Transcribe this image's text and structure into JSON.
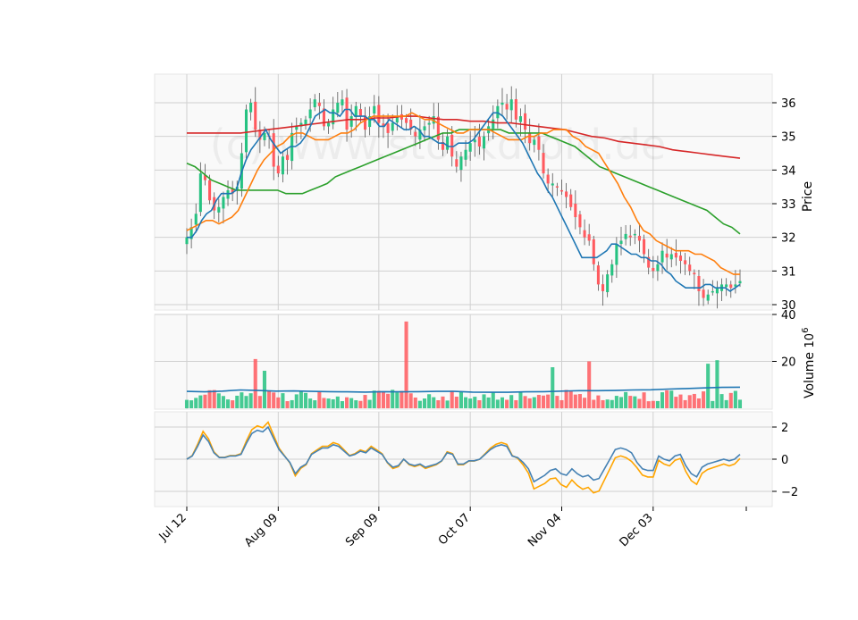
{
  "chart_data": {
    "type": "candlestick",
    "watermark": "(c) www.stockdroid.de",
    "x_ticks": [
      "Jul 12",
      "Aug 09",
      "Sep 09",
      "Oct 07",
      "Nov 04",
      "Dec 03"
    ],
    "x_tick_days": [
      0,
      20,
      42,
      62,
      82,
      102
    ],
    "n_days": 122,
    "colors": {
      "up": "#26c281",
      "down": "#ff5a5f",
      "ma5": "#1f77b4",
      "ma10": "#ff7f0e",
      "ma20": "#2ca02c",
      "ma50": "#d62728",
      "volume_ma": "#1f77b4",
      "osc_a": "#4682b4",
      "osc_b": "#ffa500"
    },
    "price": {
      "ylabel": "Price",
      "ylim": [
        29.7,
        36.8
      ],
      "yticks": [
        30,
        31,
        32,
        33,
        34,
        35,
        36
      ],
      "closes": [
        32.0,
        32.3,
        32.7,
        33.9,
        33.7,
        33.1,
        32.8,
        32.9,
        33.2,
        33.4,
        33.3,
        33.5,
        34.5,
        35.8,
        36.0,
        35.2,
        34.9,
        35.1,
        35.0,
        34.1,
        33.9,
        34.4,
        34.3,
        35.1,
        35.3,
        35.4,
        35.5,
        35.8,
        36.1,
        35.9,
        35.3,
        35.4,
        35.8,
        36.0,
        36.1,
        35.2,
        35.6,
        35.9,
        35.6,
        35.2,
        35.6,
        35.9,
        35.4,
        35.3,
        35.1,
        35.4,
        35.6,
        35.5,
        35.4,
        35.2,
        35.0,
        35.2,
        35.3,
        35.4,
        35.6,
        34.9,
        34.6,
        35.0,
        34.4,
        34.1,
        34.4,
        34.6,
        34.8,
        34.9,
        34.7,
        35.0,
        35.3,
        35.5,
        35.9,
        36.0,
        35.8,
        36.1,
        35.5,
        35.6,
        35.2,
        34.8,
        34.9,
        34.6,
        33.9,
        33.6,
        33.6,
        33.5,
        33.4,
        33.2,
        32.9,
        32.6,
        32.3,
        32.0,
        31.9,
        31.2,
        30.6,
        30.4,
        30.9,
        31.2,
        31.8,
        31.9,
        32.1,
        32.0,
        32.1,
        31.9,
        31.5,
        31.1,
        31.0,
        31.2,
        31.6,
        31.4,
        31.5,
        31.4,
        31.3,
        31.2,
        31.0,
        30.9,
        30.4,
        30.2,
        30.3,
        30.4,
        30.5,
        30.6,
        30.6,
        30.5,
        30.6,
        30.7
      ],
      "ma5": [
        32.0,
        32.0,
        32.2,
        32.5,
        32.7,
        32.8,
        33.1,
        33.3,
        33.3,
        33.3,
        33.4,
        33.9,
        34.3,
        34.6,
        34.8,
        35.0,
        35.2,
        34.9,
        34.7,
        34.5,
        34.6,
        34.7,
        34.7,
        34.8,
        35.0,
        35.3,
        35.6,
        35.7,
        35.8,
        35.7,
        35.7,
        35.6,
        35.8,
        35.8,
        35.6,
        35.6,
        35.6,
        35.5,
        35.5,
        35.3,
        35.3,
        35.5,
        35.4,
        35.3,
        35.2,
        35.2,
        35.3,
        35.2,
        35.0,
        35.0,
        34.9,
        34.8,
        34.8,
        34.7,
        34.7,
        34.8,
        34.8,
        34.8,
        34.9,
        35.1,
        35.3,
        35.5,
        35.7,
        35.7,
        35.6,
        35.4,
        35.2,
        35.0,
        34.8,
        34.5,
        34.2,
        33.9,
        33.7,
        33.4,
        33.2,
        32.9,
        32.6,
        32.3,
        32.0,
        31.7,
        31.4,
        31.4,
        31.4,
        31.4,
        31.5,
        31.6,
        31.8,
        31.8,
        31.7,
        31.6,
        31.5,
        31.5,
        31.4,
        31.4,
        31.3,
        31.3,
        31.2,
        31.0,
        30.9,
        30.7,
        30.6,
        30.5,
        30.5,
        30.5,
        30.5,
        30.6,
        30.6,
        30.5,
        30.5,
        30.5,
        30.4,
        30.5,
        30.6
      ],
      "ma10": [
        32.2,
        32.3,
        32.4,
        32.5,
        32.5,
        32.4,
        32.5,
        32.6,
        32.8,
        33.2,
        33.6,
        34.0,
        34.3,
        34.5,
        34.7,
        34.8,
        35.0,
        35.1,
        35.1,
        35.0,
        34.9,
        34.9,
        34.9,
        35.0,
        35.1,
        35.1,
        35.2,
        35.4,
        35.5,
        35.6,
        35.6,
        35.6,
        35.6,
        35.6,
        35.6,
        35.7,
        35.6,
        35.5,
        35.5,
        35.4,
        35.3,
        35.2,
        35.1,
        35.1,
        35.2,
        35.2,
        35.2,
        35.2,
        35.1,
        35.0,
        34.9,
        34.9,
        34.9,
        35.0,
        35.0,
        35.1,
        35.1,
        35.2,
        35.2,
        35.2,
        35.0,
        34.9,
        34.7,
        34.6,
        34.5,
        34.2,
        33.9,
        33.6,
        33.2,
        32.9,
        32.5,
        32.2,
        32.1,
        31.9,
        31.8,
        31.7,
        31.6,
        31.6,
        31.6,
        31.5,
        31.5,
        31.4,
        31.3,
        31.1,
        31.0,
        30.9,
        30.9
      ],
      "ma20": [
        34.2,
        34.1,
        33.9,
        33.7,
        33.6,
        33.5,
        33.4,
        33.4,
        33.4,
        33.4,
        33.4,
        33.4,
        33.3,
        33.3,
        33.3,
        33.4,
        33.5,
        33.6,
        33.8,
        33.9,
        34.0,
        34.1,
        34.2,
        34.3,
        34.4,
        34.5,
        34.6,
        34.7,
        34.8,
        34.9,
        35.0,
        35.1,
        35.1,
        35.2,
        35.2,
        35.2,
        35.2,
        35.2,
        35.2,
        35.1,
        35.1,
        35.1,
        35.1,
        35.1,
        35.0,
        34.9,
        34.8,
        34.7,
        34.5,
        34.3,
        34.1,
        34.0,
        33.9,
        33.8,
        33.7,
        33.6,
        33.5,
        33.4,
        33.3,
        33.2,
        33.1,
        33.0,
        32.9,
        32.8,
        32.6,
        32.4,
        32.3,
        32.1
      ],
      "ma50": [
        35.1,
        35.1,
        35.1,
        35.1,
        35.1,
        35.15,
        35.2,
        35.25,
        35.3,
        35.35,
        35.4,
        35.45,
        35.5,
        35.5,
        35.55,
        35.55,
        35.6,
        35.6,
        35.55,
        35.5,
        35.5,
        35.45,
        35.45,
        35.4,
        35.4,
        35.35,
        35.3,
        35.25,
        35.2,
        35.1,
        35.0,
        34.95,
        34.85,
        34.8,
        34.75,
        34.7,
        34.6,
        34.55,
        34.5,
        34.45,
        34.4,
        34.35
      ]
    },
    "volume": {
      "ylabel": "Volume",
      "ylabel_exp": "10^6",
      "ylim": [
        0,
        40
      ],
      "yticks": [
        20,
        40
      ],
      "ma_values": [
        7.2,
        7.0,
        7.3,
        7.8,
        7.6,
        7.3,
        7.4,
        7.2,
        7.1,
        7.0,
        6.9,
        7.1,
        7.0,
        7.1,
        7.2,
        7.2,
        6.9,
        6.8,
        6.8,
        7.0,
        7.1,
        7.3,
        7.5,
        7.5,
        7.6,
        7.8,
        7.9,
        8.2,
        8.4,
        8.7,
        8.9,
        9.0
      ]
    },
    "oscillator": {
      "ylim": [
        -2.9,
        2.9
      ],
      "yticks": [
        -2,
        0,
        2
      ],
      "series_a": [
        0.0,
        0.2,
        0.8,
        1.5,
        1.1,
        0.4,
        0.1,
        0.1,
        0.2,
        0.2,
        0.3,
        1.0,
        1.6,
        1.8,
        1.7,
        2.0,
        1.3,
        0.6,
        0.2,
        -0.2,
        -0.9,
        -0.5,
        -0.3,
        0.3,
        0.5,
        0.7,
        0.7,
        0.9,
        0.8,
        0.5,
        0.2,
        0.3,
        0.5,
        0.4,
        0.7,
        0.5,
        0.3,
        -0.2,
        -0.5,
        -0.4,
        0.0,
        -0.3,
        -0.4,
        -0.3,
        -0.5,
        -0.4,
        -0.3,
        -0.1,
        0.4,
        0.3,
        -0.3,
        -0.3,
        -0.1,
        -0.1,
        0.0,
        0.3,
        0.6,
        0.8,
        0.9,
        0.8,
        0.2,
        0.1,
        -0.2,
        -0.6,
        -1.4,
        -1.2,
        -1.0,
        -0.7,
        -0.6,
        -0.9,
        -1.0,
        -0.6,
        -0.9,
        -1.1,
        -1.0,
        -1.3,
        -1.2,
        -0.6,
        0.0,
        0.6,
        0.7,
        0.6,
        0.4,
        -0.2,
        -0.6,
        -0.7,
        -0.7,
        0.2,
        0.0,
        -0.1,
        0.2,
        0.3,
        -0.4,
        -0.9,
        -1.1,
        -0.5,
        -0.3,
        -0.2,
        -0.1,
        0.0,
        -0.1,
        0.0,
        0.3
      ]
    }
  }
}
